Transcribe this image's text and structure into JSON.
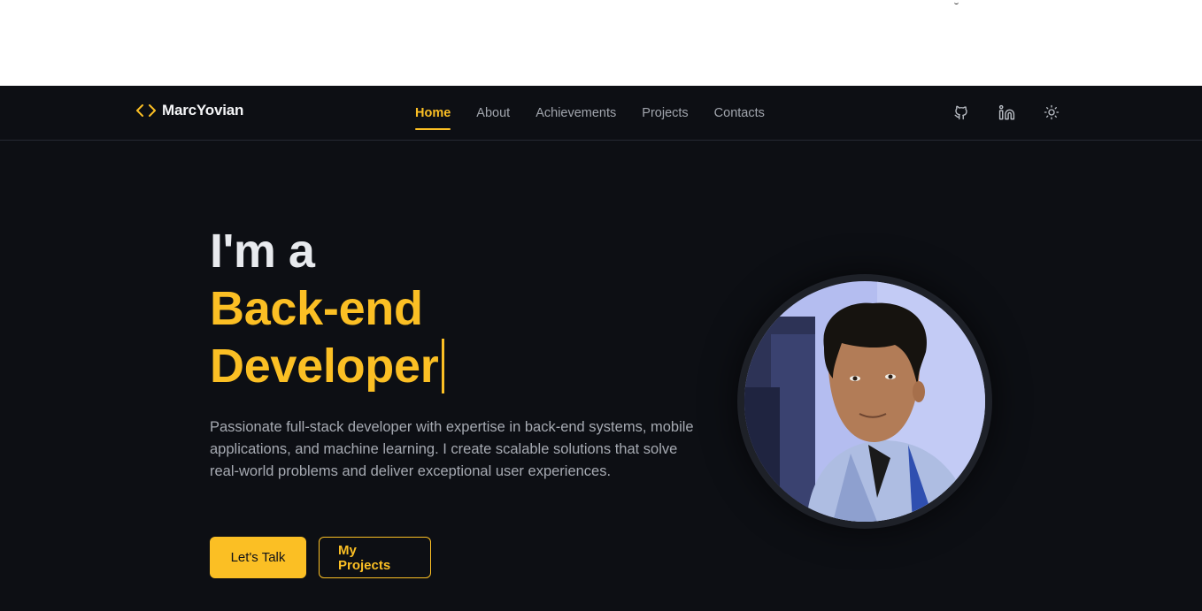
{
  "brand": {
    "name": "MarcYovian",
    "icon": "code-brackets-icon",
    "accent": "#fbbf24"
  },
  "nav": {
    "items": [
      {
        "label": "Home",
        "active": true
      },
      {
        "label": "About",
        "active": false
      },
      {
        "label": "Achievements",
        "active": false
      },
      {
        "label": "Projects",
        "active": false
      },
      {
        "label": "Contacts",
        "active": false
      }
    ],
    "icons": [
      "github-icon",
      "linkedin-icon",
      "sun-icon"
    ]
  },
  "hero": {
    "intro": "I'm a",
    "role": "Back-end Developer",
    "description": "Passionate full-stack developer with expertise in back-end systems, mobile applications, and machine learning. I create scalable solutions that solve real-world problems and deliver exceptional user experiences.",
    "primary_button": "Let's Talk",
    "secondary_button": "My Projects"
  },
  "colors": {
    "background": "#0d0f14",
    "accent": "#fbbf24",
    "text": "#e8eaee",
    "muted": "#a6aab2"
  }
}
